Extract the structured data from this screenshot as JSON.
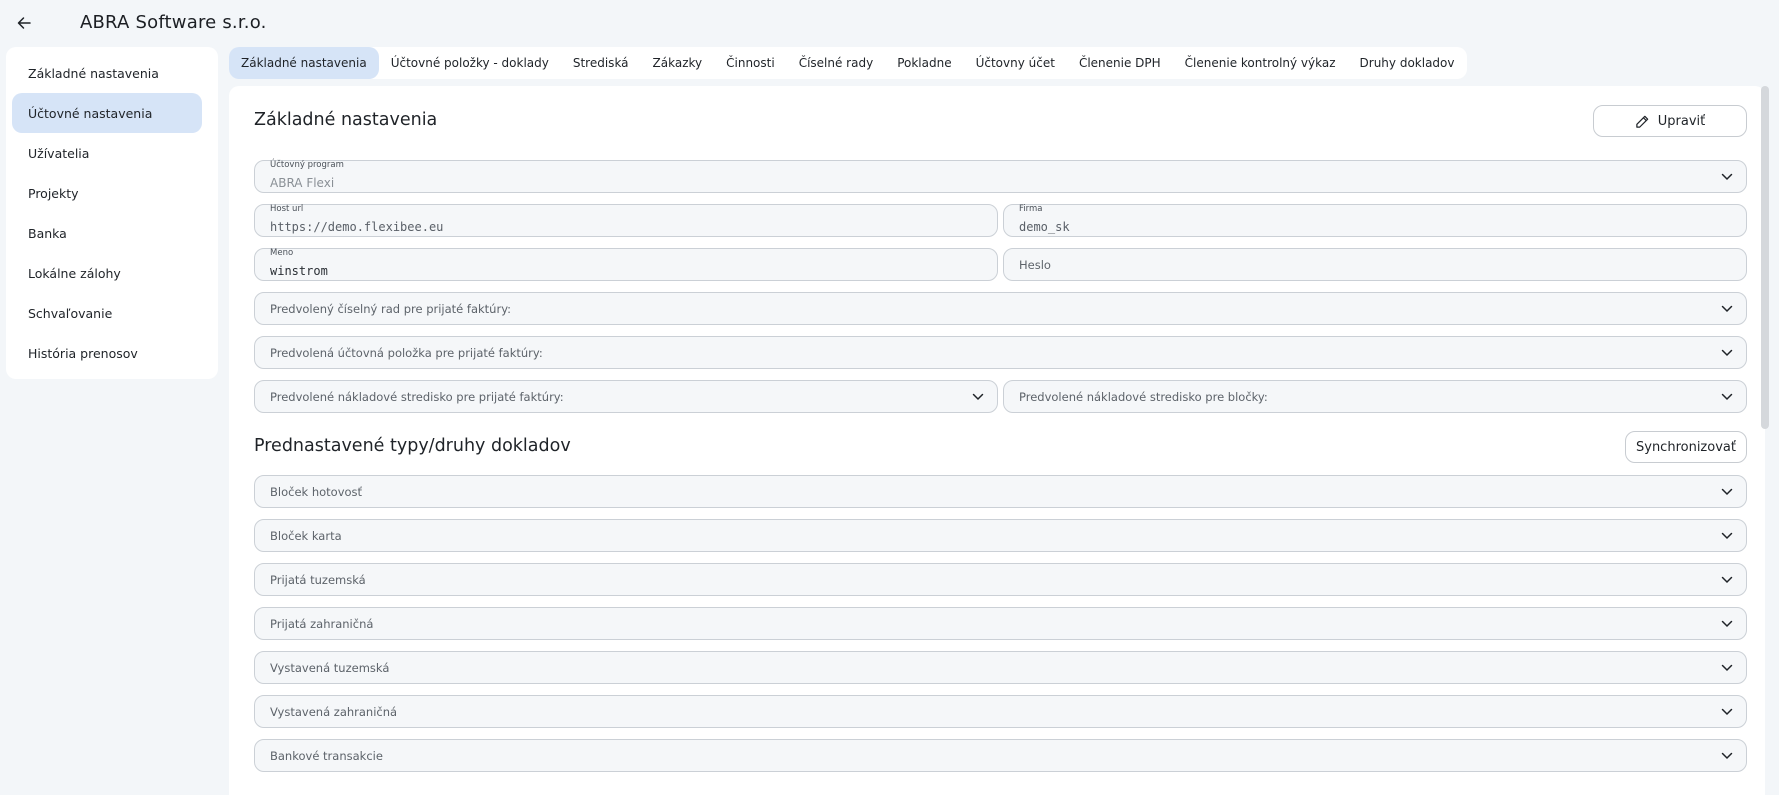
{
  "header": {
    "title": "ABRA Software s.r.o."
  },
  "sidebar": {
    "items": [
      {
        "label": "Základné nastavenia"
      },
      {
        "label": "Účtovné nastavenia"
      },
      {
        "label": "Užívatelia"
      },
      {
        "label": "Projekty"
      },
      {
        "label": "Banka"
      },
      {
        "label": "Lokálne zálohy"
      },
      {
        "label": "Schvaľovanie"
      },
      {
        "label": "História prenosov"
      }
    ],
    "active_index": 1
  },
  "tabs": [
    {
      "label": "Základné nastavenia"
    },
    {
      "label": "Účtovné položky - doklady"
    },
    {
      "label": "Strediská"
    },
    {
      "label": "Zákazky"
    },
    {
      "label": "Činnosti"
    },
    {
      "label": "Číselné rady"
    },
    {
      "label": "Pokladne"
    },
    {
      "label": "Účtovny účet"
    },
    {
      "label": "Členenie DPH"
    },
    {
      "label": "Členenie kontrolný výkaz"
    },
    {
      "label": "Druhy dokladov"
    }
  ],
  "basic": {
    "title": "Základné nastavenia",
    "edit_label": "Upraviť",
    "accounting_program": {
      "label": "Účtovný program",
      "value": "ABRA Flexi"
    },
    "host_url": {
      "label": "Host url",
      "value": "https://demo.flexibee.eu"
    },
    "firma": {
      "label": "Firma",
      "value": "demo_sk"
    },
    "meno": {
      "label": "Meno",
      "value": "winstrom"
    },
    "heslo": {
      "placeholder": "Heslo"
    },
    "default_series": "Predvolený číselný rad pre prijaté faktúry:",
    "default_item": "Predvolená účtovná položka pre prijaté faktúry:",
    "default_center_invoices": "Predvolené nákladové stredisko pre prijaté faktúry:",
    "default_center_receipts": "Predvolené nákladové stredisko pre bločky:"
  },
  "doc_types": {
    "title": "Prednastavené typy/druhy dokladov",
    "sync_label": "Synchronizovať",
    "items": [
      {
        "label": "Bloček hotovosť"
      },
      {
        "label": "Bloček karta"
      },
      {
        "label": "Prijatá tuzemská"
      },
      {
        "label": "Prijatá zahraničná"
      },
      {
        "label": "Vystavená tuzemská"
      },
      {
        "label": "Vystavená zahraničná"
      },
      {
        "label": "Bankové transakcie"
      }
    ]
  },
  "icons": {
    "back": "arrow-left-icon",
    "edit": "pencil-icon",
    "dropdown": "chevron-down-icon"
  },
  "colors": {
    "active_bg": "#d6e4f7",
    "page_bg": "#f3f6f9",
    "field_bg": "#f5f7f9"
  }
}
